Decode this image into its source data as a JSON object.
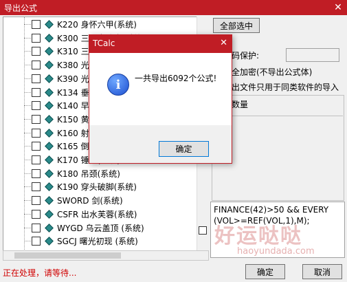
{
  "window": {
    "title": "导出公式",
    "close_glyph": "✕"
  },
  "tree_items": [
    "K220 身怀六甲(系统)",
    "K300 三个白武士(系统)",
    "K310 三只乌鸦(系统)",
    "K380 光头阳线(系统)",
    "K390 光脚阴线(系统)",
    "K134 垂死十字(系统)",
    "K140 早晨之星(系统)",
    "K150 黄昏之星(系统)",
    "K160 射击之星(系统)",
    "K165 倒锤头(系统)",
    "K170 锤头(系统)",
    "K180 吊颈(系统)",
    "K190 穿头破脚(系统)",
    "SWORD 剑(系统)",
    "CSFR 出水芙蓉(系统)",
    "WYGD 乌云盖顶 (系统)",
    "SGCJ 曙光初现 (系统)"
  ],
  "right_panel": {
    "select_all": "全部选中",
    "password_label": "码保护:",
    "password_value": "",
    "encrypt_option": "全加密(不导出公式体)",
    "export_option": "出文件只用于同类软件的导入",
    "count_label": "数量",
    "formula_text": "FINANCE(42)>50 && EVERY (VOL>=REF(VOL,1),M);"
  },
  "status_text": "正在处理，请等待...",
  "buttons": {
    "ok": "确定",
    "cancel": "取消"
  },
  "watermark": {
    "text": "好运哒哒",
    "url": "haoyundada.com"
  },
  "dialog": {
    "title": "TCalc",
    "close_glyph": "✕",
    "message": "一共导出6092个公式!",
    "ok": "确定",
    "icon": "info-icon"
  },
  "colors": {
    "titlebar": "#c01d25",
    "status": "#d00000"
  }
}
